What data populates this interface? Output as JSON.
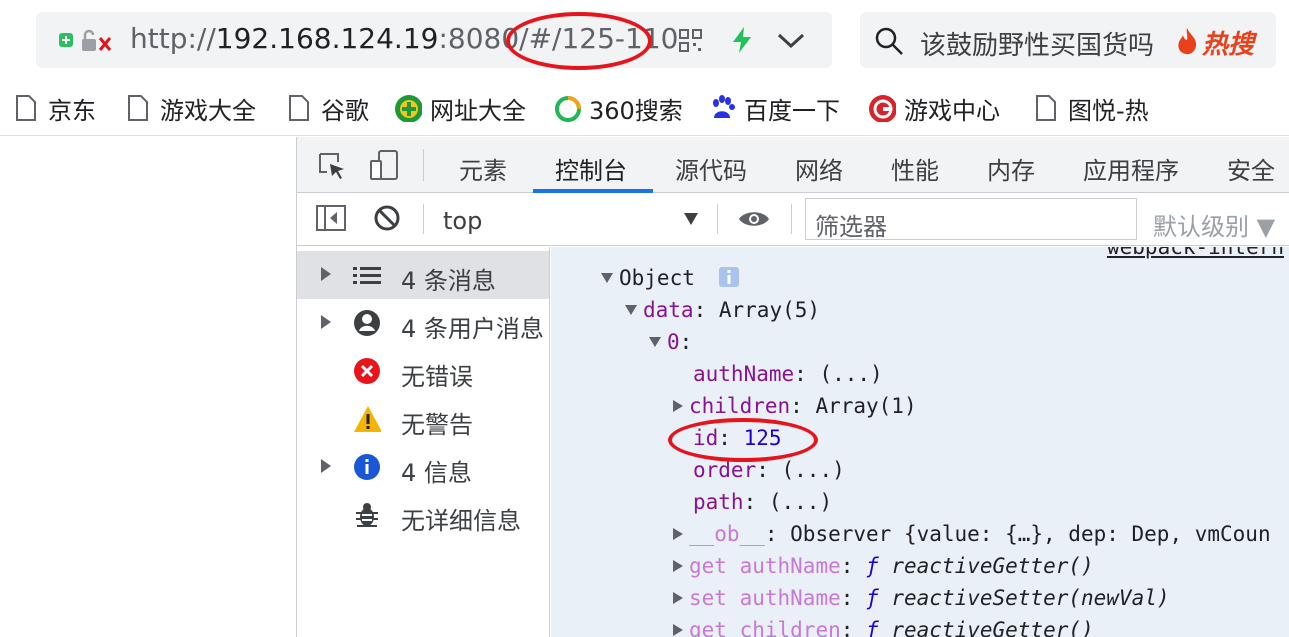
{
  "address_bar": {
    "url_scheme": "http://",
    "url_host": "192.168.124.19",
    "url_rest": ":8080/#/125-110"
  },
  "search_bar": {
    "placeholder": "该鼓励野性买国货吗",
    "hot_label": "热搜"
  },
  "bookmarks": [
    {
      "label": "京东",
      "icon": "page-icon"
    },
    {
      "label": "游戏大全",
      "icon": "page-icon"
    },
    {
      "label": "谷歌",
      "icon": "page-icon"
    },
    {
      "label": "网址大全",
      "icon": "plus-circle-icon"
    },
    {
      "label": "360搜索",
      "icon": "360-search-icon"
    },
    {
      "label": "百度一下",
      "icon": "baidu-paw-icon"
    },
    {
      "label": "游戏中心",
      "icon": "game-g-icon"
    },
    {
      "label": "图悦-热",
      "icon": "page-icon"
    }
  ],
  "devtools": {
    "tabs": [
      "元素",
      "控制台",
      "源代码",
      "网络",
      "性能",
      "内存",
      "应用程序",
      "安全"
    ],
    "active_tab": "控制台",
    "context": "top",
    "filter_placeholder": "筛选器",
    "level": "默认级别 ▼",
    "sidebar": [
      {
        "label": "4 条消息",
        "icon": "list-icon",
        "expandable": true
      },
      {
        "label": "4 条用户消息",
        "icon": "user-icon",
        "expandable": true
      },
      {
        "label": "无错误",
        "icon": "error-icon",
        "expandable": false
      },
      {
        "label": "无警告",
        "icon": "warning-icon",
        "expandable": false
      },
      {
        "label": "4 信息",
        "icon": "info-icon",
        "expandable": true
      },
      {
        "label": "无详细信息",
        "icon": "bug-icon",
        "expandable": false
      }
    ],
    "source_link": "webpack-intern",
    "console": {
      "object_label": "Object",
      "data_key": "data",
      "data_val": "Array(5)",
      "idx_key": "0",
      "authName_key": "authName",
      "lazy_val": "(...)",
      "children_key": "children",
      "children_val": "Array(1)",
      "id_key": "id",
      "id_val": "125",
      "order_key": "order",
      "path_key": "path",
      "ob_key": "__ob__",
      "ob_val": "Observer {value: {…}, dep: Dep, vmCoun",
      "get_kw": "get",
      "set_kw": "set",
      "f_sym": "ƒ",
      "getter_fn": "reactiveGetter()",
      "setter_fn": "reactiveSetter(newVal)"
    }
  },
  "colors": {
    "accent": "#1a73e8",
    "annotation": "#e8141b",
    "key_purple": "#881391",
    "number_blue": "#1c00cf"
  }
}
